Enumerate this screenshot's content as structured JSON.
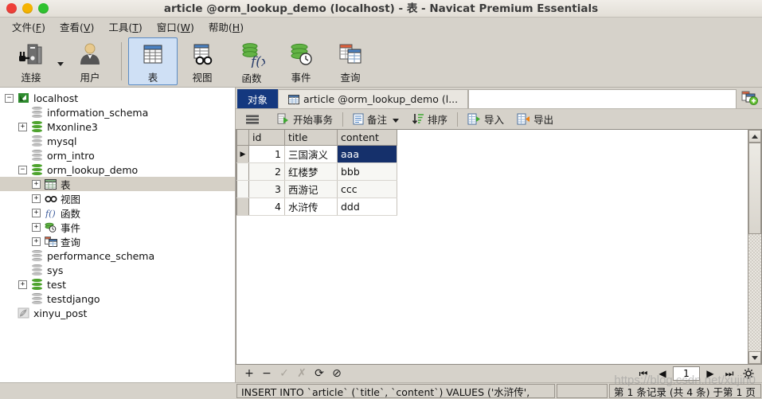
{
  "window": {
    "title": "article @orm_lookup_demo (localhost) - 表 - Navicat Premium Essentials",
    "controls": {
      "close": "close-button",
      "minimize": "minimize-button",
      "maximize": "maximize-button"
    }
  },
  "menubar": {
    "items": [
      {
        "label": "文件(F)",
        "pre": "文件(",
        "key": "F",
        "post": ")"
      },
      {
        "label": "查看(V)",
        "pre": "查看(",
        "key": "V",
        "post": ")"
      },
      {
        "label": "工具(T)",
        "pre": "工具(",
        "key": "T",
        "post": ")"
      },
      {
        "label": "窗口(W)",
        "pre": "窗口(",
        "key": "W",
        "post": ")"
      },
      {
        "label": "帮助(H)",
        "pre": "帮助(",
        "key": "H",
        "post": ")"
      }
    ]
  },
  "toolbar": {
    "items": [
      {
        "label": "连接",
        "icon": "connection-icon",
        "selected": false
      },
      {
        "label": "用户",
        "icon": "user-icon",
        "selected": false
      },
      {
        "label": "表",
        "icon": "table-icon",
        "selected": true
      },
      {
        "label": "视图",
        "icon": "view-icon",
        "selected": false
      },
      {
        "label": "函数",
        "icon": "function-icon",
        "selected": false
      },
      {
        "label": "事件",
        "icon": "event-icon",
        "selected": false
      },
      {
        "label": "查询",
        "icon": "query-icon",
        "selected": false
      }
    ]
  },
  "sidebar": {
    "nodes": [
      {
        "label": "localhost",
        "depth": 0,
        "expander": "-",
        "icon": "navicat-connection-icon",
        "selected": false
      },
      {
        "label": "information_schema",
        "depth": 1,
        "expander": "",
        "icon": "database-gray-icon",
        "selected": false
      },
      {
        "label": "Mxonline3",
        "depth": 1,
        "expander": "+",
        "icon": "database-green-icon",
        "selected": false
      },
      {
        "label": "mysql",
        "depth": 1,
        "expander": "",
        "icon": "database-gray-icon",
        "selected": false
      },
      {
        "label": "orm_intro",
        "depth": 1,
        "expander": "",
        "icon": "database-gray-icon",
        "selected": false
      },
      {
        "label": "orm_lookup_demo",
        "depth": 1,
        "expander": "-",
        "icon": "database-green-icon",
        "selected": false
      },
      {
        "label": "表",
        "depth": 2,
        "expander": "+",
        "icon": "table-icon",
        "selected": true
      },
      {
        "label": "视图",
        "depth": 2,
        "expander": "+",
        "icon": "view-icon",
        "selected": false
      },
      {
        "label": "函数",
        "depth": 2,
        "expander": "+",
        "icon": "function-icon",
        "selected": false
      },
      {
        "label": "事件",
        "depth": 2,
        "expander": "+",
        "icon": "event-icon",
        "selected": false
      },
      {
        "label": "查询",
        "depth": 2,
        "expander": "+",
        "icon": "query-icon",
        "selected": false
      },
      {
        "label": "performance_schema",
        "depth": 1,
        "expander": "",
        "icon": "database-gray-icon",
        "selected": false
      },
      {
        "label": "sys",
        "depth": 1,
        "expander": "",
        "icon": "database-gray-icon",
        "selected": false
      },
      {
        "label": "test",
        "depth": 1,
        "expander": "+",
        "icon": "database-green-icon",
        "selected": false
      },
      {
        "label": "testdjango",
        "depth": 1,
        "expander": "",
        "icon": "database-gray-icon",
        "selected": false
      },
      {
        "label": "xinyu_post",
        "depth": 0,
        "expander": "",
        "icon": "feather-icon",
        "selected": false
      }
    ]
  },
  "tabs": {
    "items": [
      {
        "label": "对象",
        "active": true,
        "icon": ""
      },
      {
        "label": "article @orm_lookup_demo (l...",
        "active": false,
        "icon": "table-icon"
      }
    ],
    "new_tab_icon": "new-query-tab-icon"
  },
  "grid_toolbar": {
    "menu_icon": "hamburger-menu-icon",
    "items": [
      {
        "label": "开始事务",
        "icon": "begin-transaction-icon",
        "caret": false
      },
      {
        "label": "备注",
        "icon": "note-icon",
        "caret": true
      },
      {
        "label": "排序",
        "icon": "sort-icon",
        "caret": false
      },
      {
        "label": "导入",
        "icon": "import-icon",
        "caret": false
      },
      {
        "label": "导出",
        "icon": "export-icon",
        "caret": false
      }
    ]
  },
  "grid": {
    "columns": [
      "id",
      "title",
      "content"
    ],
    "rows": [
      {
        "id": "1",
        "title": "三国演义",
        "content": "aaa",
        "current": true,
        "selected_cell": "content"
      },
      {
        "id": "2",
        "title": "红楼梦",
        "content": "bbb",
        "current": false,
        "selected_cell": ""
      },
      {
        "id": "3",
        "title": "西游记",
        "content": "ccc",
        "current": false,
        "selected_cell": ""
      },
      {
        "id": "4",
        "title": "水浒传",
        "content": "ddd",
        "current": false,
        "selected_cell": ""
      }
    ],
    "row_indicator": "▶"
  },
  "record_toolbar": {
    "buttons": [
      {
        "icon": "add-record-icon",
        "glyph": "+",
        "enabled": true
      },
      {
        "icon": "delete-record-icon",
        "glyph": "−",
        "enabled": true
      },
      {
        "icon": "apply-change-icon",
        "glyph": "✓",
        "enabled": false
      },
      {
        "icon": "cancel-change-icon",
        "glyph": "✗",
        "enabled": false
      },
      {
        "icon": "refresh-icon",
        "glyph": "⟳",
        "enabled": true
      },
      {
        "icon": "stop-icon",
        "glyph": "⊘",
        "enabled": true
      }
    ]
  },
  "pager": {
    "first": "⏮",
    "prev": "◀",
    "page_value": "1",
    "next": "▶",
    "last": "⏭",
    "settings_icon": "gear-icon"
  },
  "statusbar": {
    "sql": "INSERT INTO `article` (`title`, `content`) VALUES ('水浒传',",
    "middle": "",
    "record_info": "第 1 条记录 (共 4 条) 于第 1 页"
  },
  "watermark": "https://blog.csdn.net/xujin0",
  "colors": {
    "chrome": "#d6d2ca",
    "tab_active": "#14387f",
    "selection": "#15306b",
    "toolbar_selected": "#cfe0f5",
    "db_green": "#4ea32e"
  }
}
